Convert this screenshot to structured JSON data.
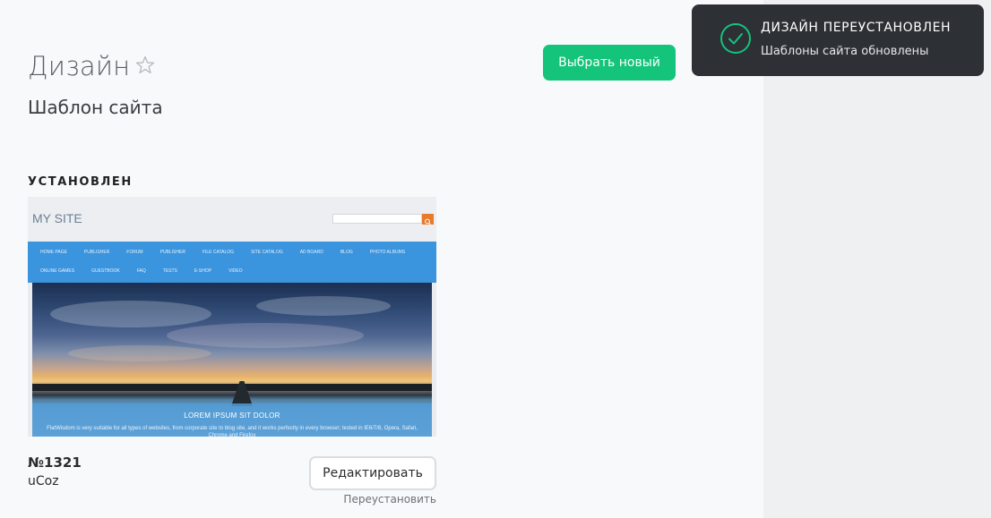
{
  "header": {
    "title": "Дизайн",
    "subtitle": "Шаблон сайта",
    "primary_button": "Выбрать новый"
  },
  "installed": {
    "section_label": "УСТАНОВЛЕН",
    "template_number": "№1321",
    "template_author": "uCoz",
    "edit_button": "Редактировать",
    "reinstall_link": "Переустановить",
    "preview": {
      "site_title": "MY SITE",
      "nav_row1": [
        "HOME PAGE",
        "PUBLISHER",
        "FORUM",
        "PUBLISHER",
        "FILE CATALOG",
        "SITE CATALOG",
        "AD BOARD",
        "BLOG",
        "PHOTO ALBUMS"
      ],
      "nav_row2": [
        "ONLINE GAMES",
        "GUESTBOOK",
        "FAQ",
        "TESTS",
        "E-SHOP",
        "VIDEO"
      ],
      "caption_title": "LOREM IPSUM SIT DOLOR",
      "caption_text": "FlatWisdom is very suitable for all types of websites, from corporate site to blog site, and it works perfectly in every browser; tested in IE6/7/8, Opera, Safari, Chrome and Firefox"
    }
  },
  "toast": {
    "title": "ДИЗАЙН ПЕРЕУСТАНОВЛЕН",
    "message": "Шаблоны сайта обновлены"
  },
  "colors": {
    "accent": "#13c47a",
    "toast_bg": "#2d3035",
    "nav_blue": "#3a94de"
  }
}
